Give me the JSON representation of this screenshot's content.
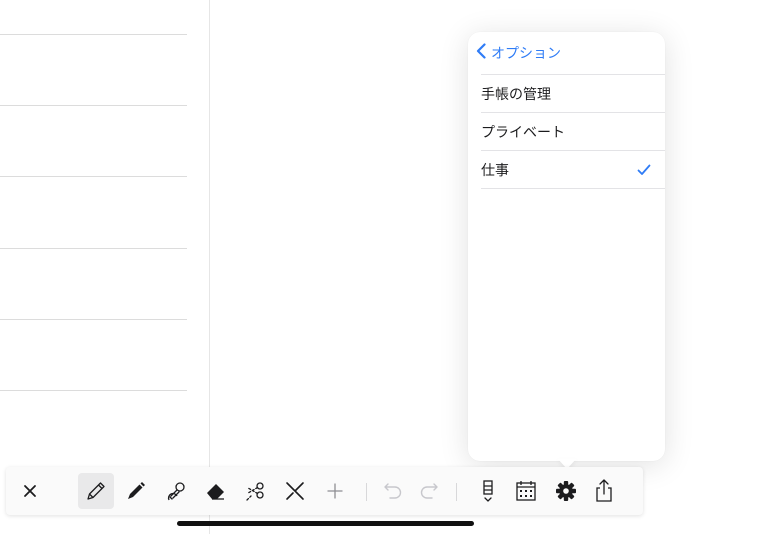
{
  "popover": {
    "back_label": "オプション",
    "items": [
      {
        "label": "手帳の管理",
        "checked": false
      },
      {
        "label": "プライベート",
        "checked": false
      },
      {
        "label": "仕事",
        "checked": true
      }
    ]
  },
  "toolbar": {
    "tools": [
      {
        "name": "close-icon"
      },
      {
        "name": "pencil-icon",
        "selected": true
      },
      {
        "name": "pen-icon"
      },
      {
        "name": "stamp-icon"
      },
      {
        "name": "eraser-icon"
      },
      {
        "name": "scissors-icon"
      },
      {
        "name": "ruler-pen-icon"
      },
      {
        "name": "plus-icon"
      },
      {
        "name": "undo-icon"
      },
      {
        "name": "redo-icon"
      },
      {
        "name": "bookmark-icon"
      },
      {
        "name": "calendar-icon"
      },
      {
        "name": "gear-icon"
      },
      {
        "name": "share-icon"
      }
    ]
  },
  "colors": {
    "accent": "#2f7cf6",
    "background": "#ffffff",
    "toolbar": "#fafafa",
    "line": "#dcdcdc"
  }
}
